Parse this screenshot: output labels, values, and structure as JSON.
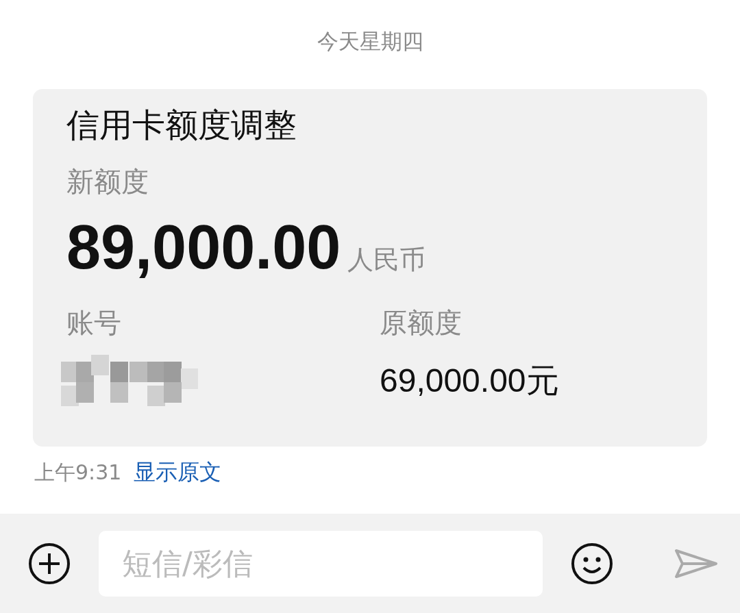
{
  "date_header": "今天星期四",
  "message": {
    "title": "信用卡额度调整",
    "new_limit_label": "新额度",
    "new_limit": "89,000.00",
    "currency": "人民币",
    "account_label": "账号",
    "account": {
      "kind": "redacted"
    },
    "old_limit_label": "原额度",
    "old_limit": "69,000.00元"
  },
  "time": "上午9:31",
  "show_original_link": "显示原文",
  "composer": {
    "placeholder": "短信/彩信"
  }
}
